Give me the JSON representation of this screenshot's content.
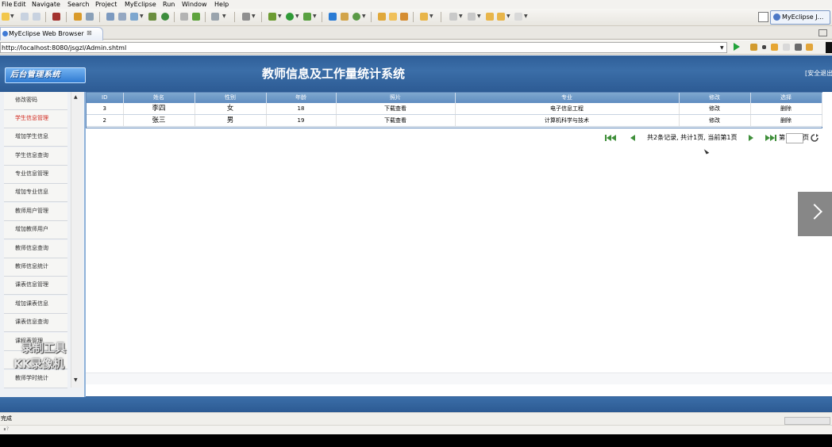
{
  "menu": [
    "File",
    "Edit",
    "Navigate",
    "Search",
    "Project",
    "MyEclipse",
    "Run",
    "Window",
    "Help"
  ],
  "perspective": {
    "label": "MyEclipse J..."
  },
  "editor_tab": {
    "label": "MyEclipse Web Browser",
    "close": "⊠"
  },
  "browser": {
    "url": "http://localhost:8080/jsgzl/Admin.shtml"
  },
  "header": {
    "logo": "后台管理系统",
    "title": "教师信息及工作量统计系统",
    "logout": "[安全退出"
  },
  "sidebar": {
    "items": [
      "修改密码",
      "学生信息管理",
      "增加学生信息",
      "学生信息查询",
      "专业信息管理",
      "增加专业信息",
      "教师用户管理",
      "增加教师用户",
      "教师信息查询",
      "教师信息统计",
      "课表信息管理",
      "增加课表信息",
      "课表信息查询",
      "课程表管理",
      "",
      "教师学时统计"
    ],
    "active_index": 1,
    "scroll_up": "▲",
    "scroll_down": "▼"
  },
  "table": {
    "headers": [
      "ID",
      "姓名",
      "性别",
      "年龄",
      "照片",
      "专业",
      "修改",
      "选择"
    ],
    "rows": [
      [
        "3",
        "李四",
        "女",
        "18",
        "下载查看",
        "电子信息工程",
        "修改",
        "删除"
      ],
      [
        "2",
        "张三",
        "男",
        "19",
        "下载查看",
        "计算机科学与技术",
        "修改",
        "删除"
      ]
    ]
  },
  "pager": {
    "summary": "共2条记录, 共计1页, 当前第1页",
    "page_prefix": "第",
    "page_suffix": "页"
  },
  "watermark": {
    "line1": "录制工具",
    "line2": "KK录像机"
  },
  "status": {
    "text": "完成",
    "extra": "∎?"
  },
  "colors": {
    "header": "#2f5d96",
    "table_header": "#6f99c7",
    "active_item": "#d22a1f"
  }
}
